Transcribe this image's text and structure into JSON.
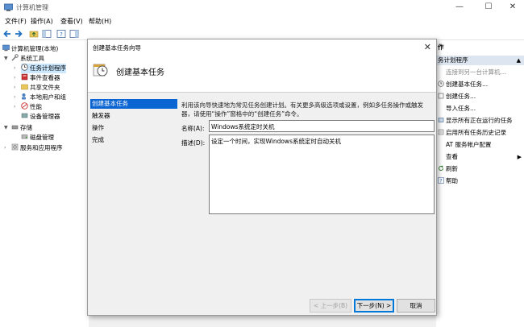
{
  "window": {
    "title": "计算机管理",
    "minimize": "—",
    "maximize": "☐",
    "close": "✕"
  },
  "menu": [
    "文件(F)",
    "操作(A)",
    "查看(V)",
    "帮助(H)"
  ],
  "tree": {
    "root": "计算机管理(本地)",
    "system_tools": "系统工具",
    "task_scheduler": "任务计划程序",
    "event_viewer": "事件查看器",
    "shared_folders": "共享文件夹",
    "local_users": "本地用户和组",
    "performance": "性能",
    "device_manager": "设备管理器",
    "storage": "存储",
    "disk_management": "磁盘管理",
    "services_apps": "服务和应用程序"
  },
  "actions": {
    "header": "作",
    "section": "务计划程序",
    "items": [
      "连接到另一台计算机...",
      "创建基本任务...",
      "创建任务...",
      "导入任务...",
      "显示所有正在运行的任务",
      "启用所有任务历史记录",
      "AT 服务帐户配置",
      "查看",
      "刷新",
      "帮助"
    ]
  },
  "wizard": {
    "title": "创建基本任务向导",
    "heading": "创建基本任务",
    "steps": [
      "创建基本任务",
      "触发器",
      "操作",
      "完成"
    ],
    "description": "利用该向导快速地为常见任务创建计划。有关更多高级选项或设置，例如多任务操作或触发器，请使用“操作”窗格中的“创建任务”命令。",
    "name_label": "名称(A):",
    "name_value": "Windows系统定时关机",
    "desc_label": "描述(D):",
    "desc_value": "设定一个时间，实现Windows系统定时自动关机",
    "back": "< 上一步(B)",
    "next": "下一步(N) >",
    "cancel": "取消"
  },
  "colors": {
    "accent": "#0a64d2",
    "selection": "#cce8ff",
    "section_header": "#dde6f0"
  }
}
